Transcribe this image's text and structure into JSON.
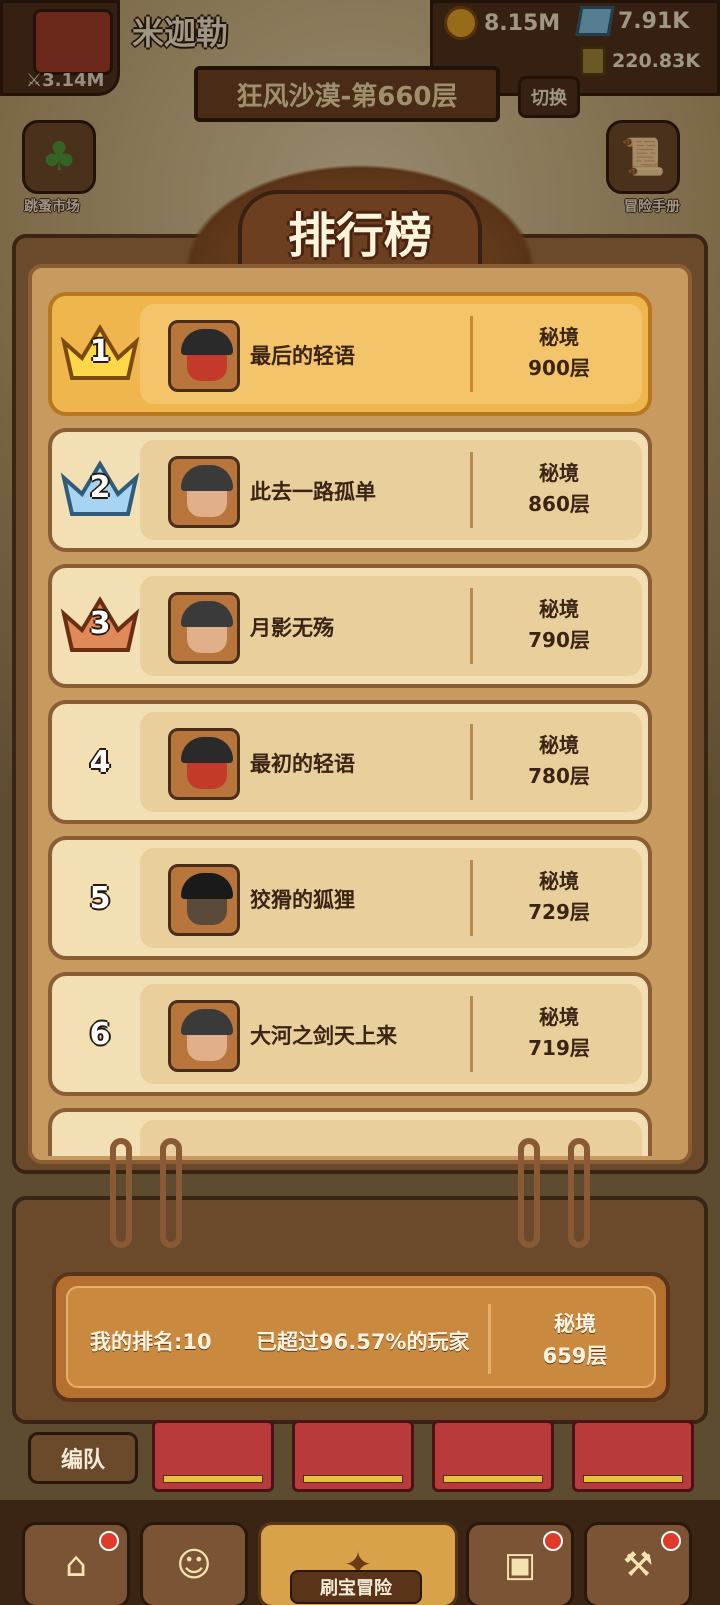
{
  "player": {
    "name": "米迦勒",
    "power": "3.14M"
  },
  "resources": {
    "gold": "8.15M",
    "gems": "7.91K",
    "potion": "220.83K"
  },
  "stage": {
    "title": "狂风沙漠-第660层",
    "switch_label": "切换"
  },
  "side_buttons": {
    "left_label": "跳蚤市场",
    "right_label": "冒险手册"
  },
  "leaderboard": {
    "title": "排行榜",
    "rows": [
      {
        "rank": "1",
        "name": "最后的轻语",
        "realm": "秘境",
        "floor": "900层"
      },
      {
        "rank": "2",
        "name": "此去一路孤单",
        "realm": "秘境",
        "floor": "860层"
      },
      {
        "rank": "3",
        "name": "月影无殇",
        "realm": "秘境",
        "floor": "790层"
      },
      {
        "rank": "4",
        "name": "最初的轻语",
        "realm": "秘境",
        "floor": "780层"
      },
      {
        "rank": "5",
        "name": "狡猾的狐狸",
        "realm": "秘境",
        "floor": "729层"
      },
      {
        "rank": "6",
        "name": "大河之剑天上来",
        "realm": "秘境",
        "floor": "719层"
      }
    ]
  },
  "my_rank": {
    "label": "我的排名:10",
    "beat": "已超过96.57%的玩家",
    "realm": "秘境",
    "floor": "659层"
  },
  "team": {
    "label": "编队"
  },
  "nav": {
    "active_label": "刷宝冒险"
  },
  "colors": {
    "gold_row": "#f0b64e",
    "row": "#f3dfb4",
    "frame": "#6b4a2c",
    "badge": "#e03a2a"
  },
  "icons": [
    "crown-gold-icon",
    "crown-silver-icon",
    "crown-bronze-icon",
    "coin-icon",
    "gem-icon",
    "potion-icon",
    "clover-icon",
    "scroll-icon"
  ]
}
